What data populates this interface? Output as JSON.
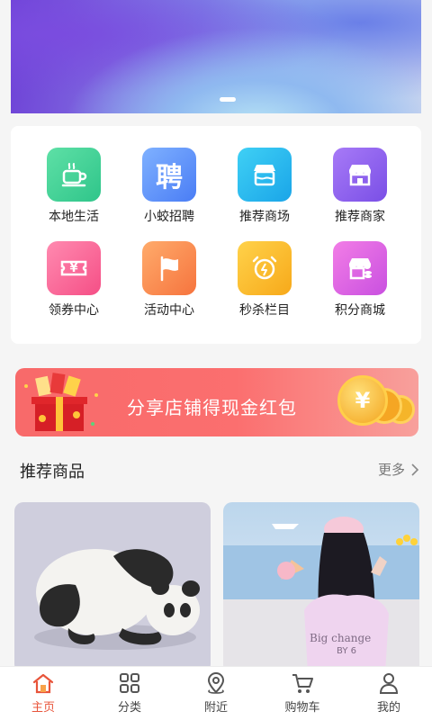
{
  "grid": {
    "items": [
      {
        "label": "本地生活",
        "icon": "coffee-cup-icon"
      },
      {
        "label": "小蛟招聘",
        "icon": "hire-icon",
        "glyph": "聘"
      },
      {
        "label": "推荐商场",
        "icon": "mall-icon"
      },
      {
        "label": "推荐商家",
        "icon": "shop-icon"
      },
      {
        "label": "领券中心",
        "icon": "coupon-icon",
        "glyph": "¥"
      },
      {
        "label": "活动中心",
        "icon": "flag-icon"
      },
      {
        "label": "秒杀栏目",
        "icon": "alarm-clock-icon"
      },
      {
        "label": "积分商城",
        "icon": "points-shop-icon"
      }
    ]
  },
  "promo": {
    "text": "分享店铺得现金红包",
    "coin_glyph": "¥"
  },
  "recommend": {
    "title": "推荐商品",
    "more_label": "更多"
  },
  "products": [
    {
      "image": "panda-illustration"
    },
    {
      "image": "girl-by-sea-illustration",
      "shirt_text": "Big change",
      "shirt_text_2": "BY 6"
    }
  ],
  "tabbar": {
    "items": [
      {
        "label": "主页",
        "icon": "home-icon",
        "active": true
      },
      {
        "label": "分类",
        "icon": "grid-icon",
        "active": false
      },
      {
        "label": "附近",
        "icon": "location-pin-icon",
        "active": false
      },
      {
        "label": "购物车",
        "icon": "cart-icon",
        "active": false
      },
      {
        "label": "我的",
        "icon": "user-icon",
        "active": false
      }
    ]
  },
  "colors": {
    "accent": "#e8543a",
    "promo": "#f86a6a"
  }
}
